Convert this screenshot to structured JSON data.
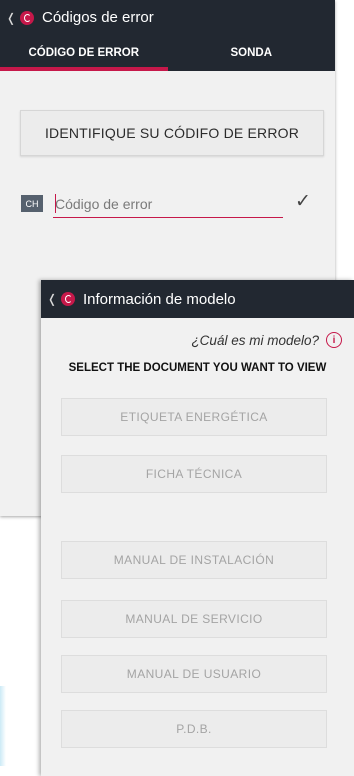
{
  "screen1": {
    "title": "Códigos de error",
    "tabs": [
      "CÓDIGO DE ERROR",
      "SONDA"
    ],
    "identify_label": "IDENTIFIQUE SU CÓDIFO DE ERROR",
    "prefix_label": "CH",
    "input_placeholder": "Código de error",
    "input_value": ""
  },
  "screen2": {
    "title": "Información de modelo",
    "which_model": "¿Cuál es mi modelo?",
    "select_title": "SELECT THE DOCUMENT YOU WANT TO VIEW",
    "documents": [
      "ETIQUETA ENERGÉTICA",
      "FICHA TÉCNICA",
      "MANUAL DE INSTALACIÓN",
      "MANUAL DE SERVICIO",
      "MANUAL DE USUARIO",
      "P.D.B."
    ]
  },
  "colors": {
    "brand": "#c6184a",
    "header_bg": "#222831",
    "panel_bg": "#f1f1f1",
    "disabled_text": "#a4a4a4"
  },
  "icons": [
    "back-chevron-icon",
    "logo-icon",
    "checkmark-icon",
    "info-icon"
  ]
}
